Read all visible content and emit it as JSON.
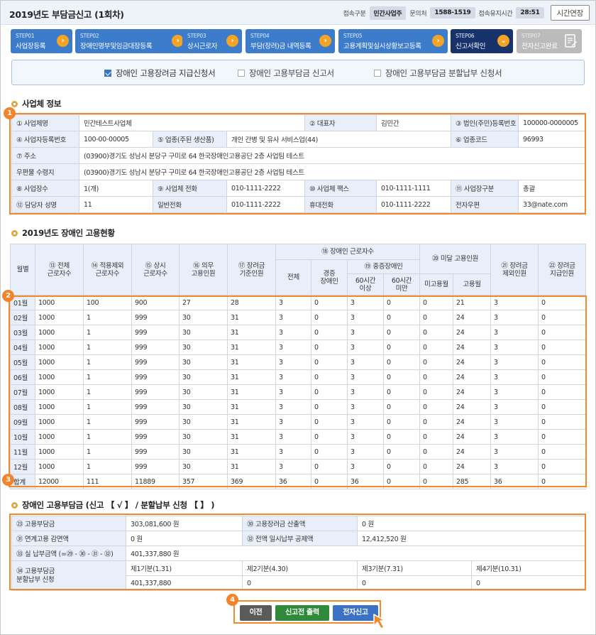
{
  "header": {
    "title": "2019년도 부담금신고 (1회차)",
    "conn_type_label": "접속구분",
    "conn_type_value": "민간사업주",
    "inquiry_label": "문의처",
    "inquiry_value": "1588-1519",
    "session_label": "접속유지시간",
    "session_value": "28:51",
    "extend_button": "시간연장"
  },
  "steps": [
    {
      "num": "STEP01",
      "label": "사업장등록"
    },
    {
      "num": "STEP02",
      "label": "장애인명부및임금대장등록"
    },
    {
      "num": "STEP03",
      "label": "상시근로자"
    },
    {
      "num": "STEP04",
      "label": "부담(장려)금 내역등록"
    },
    {
      "num": "STEP05",
      "label": "고용계획및실시상황보고등록"
    },
    {
      "num": "STEP06",
      "label": "신고서확인"
    },
    {
      "num": "STEP07",
      "label": "전자신고완료"
    }
  ],
  "forms": [
    {
      "label": "장애인 고용장려금 지급신청서",
      "checked": true
    },
    {
      "label": "장애인 고용부담금 신고서",
      "checked": false
    },
    {
      "label": "장애인 고용부담금 분할납부 신청서",
      "checked": false
    }
  ],
  "sections": {
    "company": "사업체 정보",
    "employment": "2019년도 장애인 고용현황",
    "burden": "장애인 고용부담금 (신고 【 √ 】 / 분할납부 신청 【 】 )"
  },
  "company": {
    "r1": [
      "① 사업체명",
      "민간테스트사업체",
      "② 대표자",
      "김민간",
      "③ 법인(주민)등록번호",
      "100000-0000005"
    ],
    "r2": [
      "④ 사업자등록번호",
      "100-00-00005",
      "⑤ 업종(주된 생산품)",
      "개인 간병 및 유사 서비스업(44)",
      "⑥ 업종코드",
      "96993"
    ],
    "r3": [
      "⑦ 주소",
      "(03900)경기도 성남시 분당구 구미로 64 한국장애인고용공단 2층 사업팀 테스트"
    ],
    "r4": [
      "우편물 수령지",
      "(03900)경기도 성남시 분당구 구미로 64 한국장애인고용공단 2층 사업팀 테스트"
    ],
    "r5": [
      "⑧ 사업장수",
      "1(개)",
      "⑨ 사업체 전화",
      "010-1111-2222",
      "⑩ 사업체 팩스",
      "010-1111-1111",
      "⑪ 사업장구분",
      "총괄"
    ],
    "r6": [
      "⑫ 담당자 성명",
      "11",
      "일반전화",
      "010-1111-2222",
      "휴대전화",
      "010-1111-2222",
      "전자우편",
      "33@nate.com"
    ]
  },
  "employment": {
    "headers": {
      "month": "월별",
      "h13": "⑬ 전체\n근로자수",
      "h14": "⑭ 적용제외\n근로자수",
      "h15": "⑮ 상시\n근로자수",
      "h16": "⑯ 의무\n고용인원",
      "h17": "⑰ 장려금\n기준인원",
      "h18": "⑱ 장애인 근로자수",
      "total": "전체",
      "mild": "경증\n장애인",
      "h19": "⑲ 중증장애인",
      "over60": "60시간\n이상",
      "under60": "60시간\n미만",
      "h20": "⑳ 미달 고용인원",
      "unemployed": "미고용월",
      "employed": "고용월",
      "h21": "㉑ 장려금\n제외인원",
      "h22": "㉒ 장려금\n지급인원"
    },
    "rows": [
      [
        "01월",
        "1000",
        "100",
        "900",
        "27",
        "28",
        "3",
        "0",
        "3",
        "0",
        "0",
        "21",
        "3",
        "0"
      ],
      [
        "02월",
        "1000",
        "1",
        "999",
        "30",
        "31",
        "3",
        "0",
        "3",
        "0",
        "0",
        "24",
        "3",
        "0"
      ],
      [
        "03월",
        "1000",
        "1",
        "999",
        "30",
        "31",
        "3",
        "0",
        "3",
        "0",
        "0",
        "24",
        "3",
        "0"
      ],
      [
        "04월",
        "1000",
        "1",
        "999",
        "30",
        "31",
        "3",
        "0",
        "3",
        "0",
        "0",
        "24",
        "3",
        "0"
      ],
      [
        "05월",
        "1000",
        "1",
        "999",
        "30",
        "31",
        "3",
        "0",
        "3",
        "0",
        "0",
        "24",
        "3",
        "0"
      ],
      [
        "06월",
        "1000",
        "1",
        "999",
        "30",
        "31",
        "3",
        "0",
        "3",
        "0",
        "0",
        "24",
        "3",
        "0"
      ],
      [
        "07월",
        "1000",
        "1",
        "999",
        "30",
        "31",
        "3",
        "0",
        "3",
        "0",
        "0",
        "24",
        "3",
        "0"
      ],
      [
        "08월",
        "1000",
        "1",
        "999",
        "30",
        "31",
        "3",
        "0",
        "3",
        "0",
        "0",
        "24",
        "3",
        "0"
      ],
      [
        "09월",
        "1000",
        "1",
        "999",
        "30",
        "31",
        "3",
        "0",
        "3",
        "0",
        "0",
        "24",
        "3",
        "0"
      ],
      [
        "10월",
        "1000",
        "1",
        "999",
        "30",
        "31",
        "3",
        "0",
        "3",
        "0",
        "0",
        "24",
        "3",
        "0"
      ],
      [
        "11월",
        "1000",
        "1",
        "999",
        "30",
        "31",
        "3",
        "0",
        "3",
        "0",
        "0",
        "24",
        "3",
        "0"
      ],
      [
        "12월",
        "1000",
        "1",
        "999",
        "30",
        "31",
        "3",
        "0",
        "3",
        "0",
        "0",
        "24",
        "3",
        "0"
      ],
      [
        "합계",
        "12000",
        "111",
        "11889",
        "357",
        "369",
        "36",
        "0",
        "36",
        "0",
        "0",
        "285",
        "36",
        "0"
      ]
    ]
  },
  "burden": {
    "burden_label": "㉓ 고용부담금",
    "burden_value": "303,081,600 원",
    "incentive_label": "㉚ 고용장려금 산출액",
    "incentive_value": "0 원",
    "linked_label": "㉛ 연계고용 감면액",
    "linked_value": "0 원",
    "prepaid_label": "㉜ 전액 일시납부 공제액",
    "prepaid_value": "12,412,520 원",
    "actual_label": "㉝ 실 납부금액 (=㉙ - ㉚ - ㉛ - ㉜)",
    "actual_value": "401,337,880 원",
    "install_label": "㉞ 고용부담금\n분할납부 신청",
    "periods": [
      "제1기분(1.31)",
      "제2기분(4.30)",
      "제3기분(7.31)",
      "제4기분(10.31)"
    ],
    "period_values": [
      "401,337,880",
      "0",
      "0",
      "0"
    ]
  },
  "actions": {
    "prev": "이전",
    "print": "신고전 출력",
    "submit": "전자신고"
  },
  "markers": [
    "1",
    "2",
    "3",
    "4"
  ],
  "colors": {
    "step_blue": "#3d7ccb",
    "step_active": "#18336b",
    "step_disabled": "#bbbbbb",
    "highlight_orange": "#f08a2b",
    "btn_prev": "#5b5b5b",
    "btn_print": "#2f8b3b",
    "btn_submit": "#3c72c4"
  }
}
